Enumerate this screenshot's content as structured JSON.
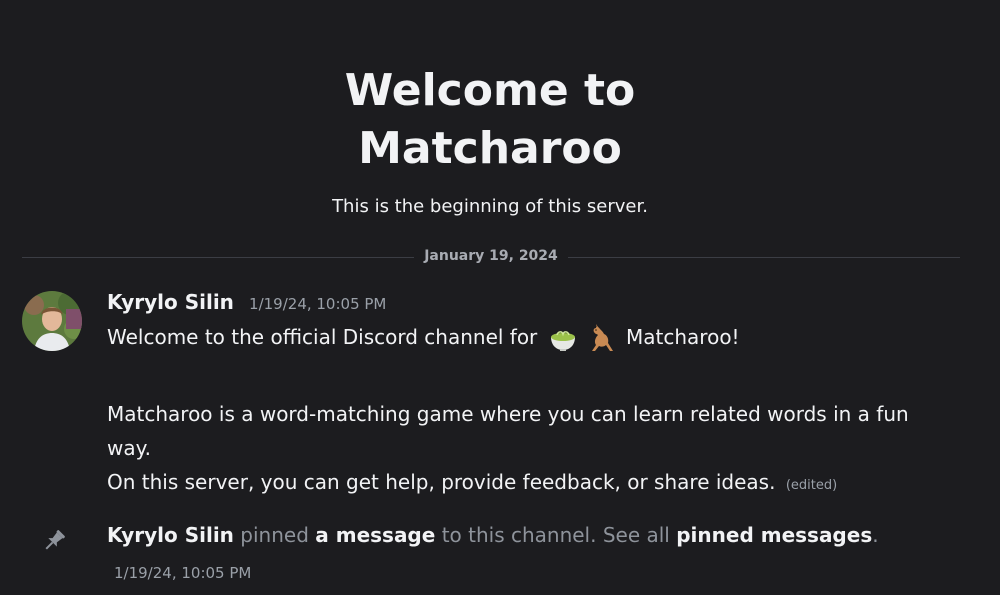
{
  "welcome": {
    "title_line1": "Welcome to",
    "title_line2": "Matcharoo",
    "subtitle": "This is the beginning of this server."
  },
  "divider": {
    "date": "January 19, 2024"
  },
  "message": {
    "author": "Kyrylo Silin",
    "timestamp": "1/19/24, 10:05 PM",
    "line1_before": "Welcome to the official Discord channel for",
    "line1_after": "Matcharoo!",
    "line2": "Matcharoo is a word-matching game where you can learn related words in a fun way.",
    "line3": "On this server, you can get help, provide feedback, or share ideas.",
    "edited": "(edited)",
    "emojis": [
      "matcha-icon",
      "kangaroo-icon"
    ]
  },
  "pinned": {
    "author": "Kyrylo Silin",
    "text_pinned": "pinned",
    "link_message": "a message",
    "text_channel": "to this channel. See all",
    "link_pinned": "pinned messages",
    "period": ".",
    "timestamp": "1/19/24, 10:05 PM"
  },
  "colors": {
    "background": "#1c1c1f",
    "text": "#f2f3f5",
    "muted": "#9aa0a8",
    "divider": "#3b3d44"
  }
}
